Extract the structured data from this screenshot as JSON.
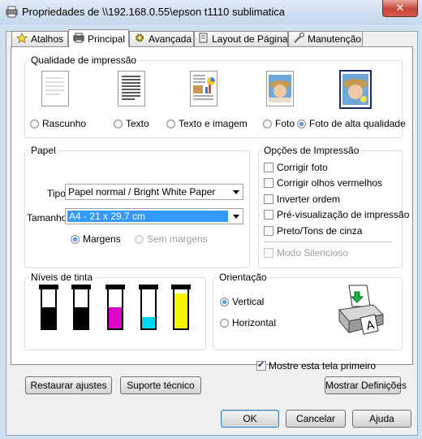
{
  "window": {
    "title": "Propriedades de \\\\192.168.0.55\\epson t1110 sublimatica",
    "close_glyph": "✕"
  },
  "tabs": [
    {
      "label": "Atalhos",
      "icon": "star-icon"
    },
    {
      "label": "Principal",
      "icon": "printer-icon",
      "active": true
    },
    {
      "label": "Avançada",
      "icon": "gear-icon"
    },
    {
      "label": "Layout de Página",
      "icon": "page-layout-icon"
    },
    {
      "label": "Manutenção",
      "icon": "wrench-icon"
    }
  ],
  "quality": {
    "label": "Qualidade de impressão",
    "selected": "Foto de alta qualidade",
    "options": [
      "Rascunho",
      "Texto",
      "Texto e imagem",
      "Foto",
      "Foto de alta qualidade"
    ]
  },
  "paper": {
    "label": "Papel",
    "type_label": "Tipo",
    "type_value": "Papel normal / Bright White Paper",
    "size_label": "Tamanho",
    "size_value": "A4 - 21 x 29,7 cm",
    "margins": "Margens",
    "no_margins": "Sem margens"
  },
  "print_options": {
    "label": "Opções de Impressão",
    "items": [
      "Corrigir foto",
      "Corrigir olhos vermelhos",
      "Inverter ordem",
      "Pré-visualização de impressão",
      "Preto/Tons de cinza"
    ],
    "silent_mode": "Modo Silencioso"
  },
  "ink": {
    "label": "Níveis de tinta",
    "colors": [
      "#000000",
      "#000000",
      "#e000c8",
      "#00d9f2",
      "#f6f600"
    ],
    "levels": [
      0.55,
      0.55,
      0.55,
      0.3,
      0.9
    ]
  },
  "orientation": {
    "label": "Orientação",
    "vertical": "Vertical",
    "horizontal": "Horizontal",
    "selected": "Vertical"
  },
  "show_first": {
    "label": "Mostre esta tela primeiro",
    "checked": true
  },
  "buttons": {
    "restore": "Restaurar ajustes",
    "support": "Suporte técnico",
    "show_settings": "Mostrar Definições",
    "ok": "OK",
    "cancel": "Cancelar",
    "help": "Ajuda"
  }
}
